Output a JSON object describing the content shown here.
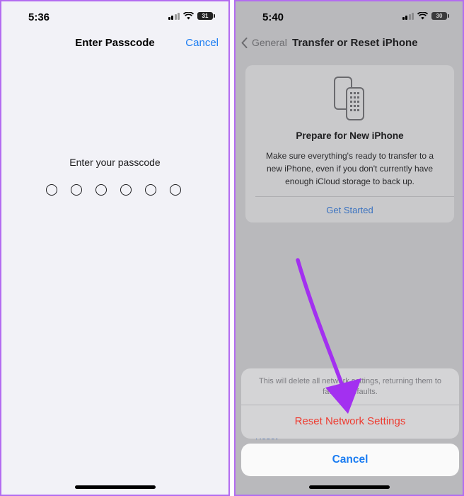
{
  "left_screen": {
    "status": {
      "time": "5:36",
      "battery": "31"
    },
    "nav": {
      "title": "Enter Passcode",
      "cancel_label": "Cancel"
    },
    "passcode": {
      "prompt": "Enter your passcode",
      "digit_count": 6
    }
  },
  "right_screen": {
    "status": {
      "time": "5:40",
      "battery": "30"
    },
    "nav": {
      "back_label": "General",
      "title": "Transfer or Reset iPhone"
    },
    "prepare_card": {
      "title": "Prepare for New iPhone",
      "description": "Make sure everything's ready to transfer to a new iPhone, even if you don't currently have enough iCloud storage to back up.",
      "action_label": "Get Started"
    },
    "behind_sheet_text": "Reset",
    "action_sheet": {
      "message": "This will delete all network settings, returning them to factory defaults.",
      "destructive_label": "Reset Network Settings",
      "cancel_label": "Cancel"
    }
  },
  "colors": {
    "system_blue": "#1a7cf2",
    "destructive_red": "#ee3b30",
    "annotation_arrow": "#a330f0",
    "frame_border": "#b36cf0"
  }
}
